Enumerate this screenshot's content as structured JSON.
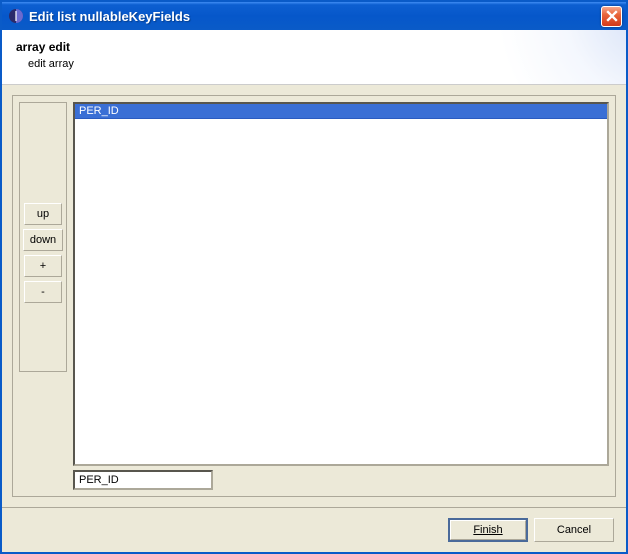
{
  "window": {
    "title": "Edit list nullableKeyFields"
  },
  "header": {
    "title": "array edit",
    "subtitle": "edit array"
  },
  "buttons": {
    "up": "up",
    "down": "down",
    "add": "+",
    "remove": "-"
  },
  "list": {
    "items": [
      "PER_ID"
    ],
    "selectedIndex": 0
  },
  "edit": {
    "value": "PER_ID"
  },
  "footer": {
    "finish": "Finish",
    "cancel": "Cancel"
  }
}
